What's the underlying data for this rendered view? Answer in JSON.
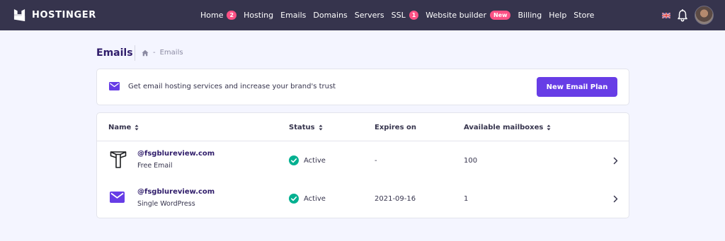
{
  "brand": {
    "name": "HOSTINGER"
  },
  "nav": {
    "items": [
      {
        "label": "Home",
        "badge": "2"
      },
      {
        "label": "Hosting",
        "badge": ""
      },
      {
        "label": "Emails",
        "badge": ""
      },
      {
        "label": "Domains",
        "badge": ""
      },
      {
        "label": "Servers",
        "badge": ""
      },
      {
        "label": "SSL",
        "badge": "1"
      },
      {
        "label": "Website builder",
        "badge": "New"
      },
      {
        "label": "Billing",
        "badge": ""
      },
      {
        "label": "Help",
        "badge": ""
      },
      {
        "label": "Store",
        "badge": ""
      }
    ],
    "icons": {
      "language": "uk-flag-icon",
      "notifications": "bell-icon",
      "profile": "avatar"
    }
  },
  "header": {
    "title": "Emails",
    "breadcrumb": {
      "home_icon": "home-icon",
      "separator": "-",
      "current": "Emails"
    }
  },
  "promo": {
    "icon": "envelope-icon",
    "text": "Get email hosting services and increase your brand's trust",
    "button_label": "New Email Plan"
  },
  "table": {
    "columns": {
      "name": "Name",
      "status": "Status",
      "expires": "Expires on",
      "mailboxes": "Available mailboxes"
    },
    "rows": [
      {
        "icon": "titan-logo-icon",
        "domain": "@fsgblureview.com",
        "plan": "Free Email",
        "status": "Active",
        "expires": "-",
        "mailboxes": "100"
      },
      {
        "icon": "envelope-icon",
        "domain": "@fsgblureview.com",
        "plan": "Single WordPress",
        "status": "Active",
        "expires": "2021-09-16",
        "mailboxes": "1"
      }
    ]
  },
  "colors": {
    "navbar": "#36344d",
    "accent": "#673de6",
    "badge": "#fc5185",
    "success": "#00b090",
    "background": "#f4f5ff"
  }
}
